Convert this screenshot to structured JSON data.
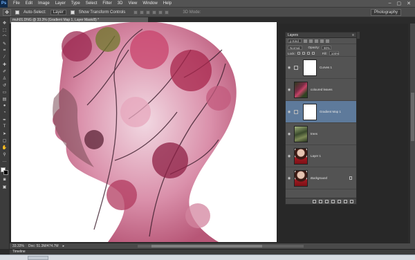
{
  "app": {
    "logo": "Ps"
  },
  "menu": [
    "File",
    "Edit",
    "Image",
    "Layer",
    "Type",
    "Select",
    "Filter",
    "3D",
    "View",
    "Window",
    "Help"
  ],
  "window_controls": [
    "–",
    "▢",
    "✕"
  ],
  "options_bar": {
    "auto_select_label": "Auto-Select:",
    "auto_select_value": "Layer",
    "show_transform_label": "Show Transform Controls",
    "mode_label": "3D Mode:",
    "workspace": "Photography"
  },
  "document": {
    "tab_title": "muh01.DNG @ 33.3% (Gradient Map 1, Layer Mask/8) *"
  },
  "layers_panel": {
    "tab_label": "Layers",
    "filter_kind": "ρ Kind",
    "blend_mode": "Normal",
    "opacity_label": "Opacity:",
    "opacity_value": "90%",
    "lock_label": "Lock:",
    "fill_label": "Fill:",
    "fill_value": "100%",
    "layers": [
      {
        "name": "Curves 1",
        "thumb": "white",
        "adjustment": true,
        "selected": false,
        "visible": true
      },
      {
        "name": "coloured leaves",
        "thumb": "leaves",
        "adjustment": false,
        "selected": false,
        "visible": true
      },
      {
        "name": "Gradient Map 1",
        "thumb": "white",
        "adjustment": true,
        "selected": true,
        "visible": true
      },
      {
        "name": "trees",
        "thumb": "trees",
        "adjustment": false,
        "selected": false,
        "visible": true
      },
      {
        "name": "Layer 1",
        "thumb": "portrait",
        "adjustment": false,
        "selected": false,
        "visible": true
      },
      {
        "name": "Background",
        "thumb": "portrait",
        "adjustment": false,
        "selected": false,
        "visible": true,
        "locked": true
      }
    ]
  },
  "status": {
    "zoom": "33.33%",
    "doc_size": "Doc: 51.3M/474.7M"
  },
  "timeline": {
    "label": "Timeline"
  }
}
